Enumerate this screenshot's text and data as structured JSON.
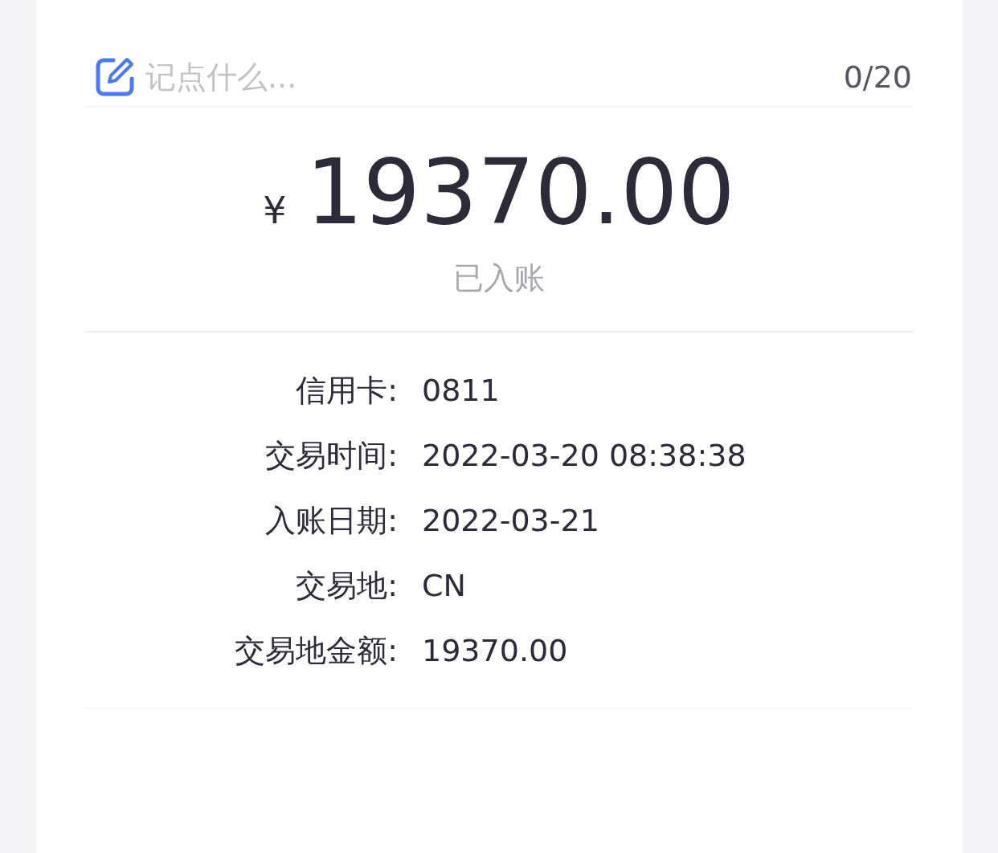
{
  "note": {
    "placeholder": "记点什么...",
    "counter": "0/20"
  },
  "amount": {
    "currency": "¥",
    "value": "19370.00",
    "status": "已入账"
  },
  "details": [
    {
      "label": "信用卡:",
      "value": "0811"
    },
    {
      "label": "交易时间:",
      "value": "2022-03-20 08:38:38"
    },
    {
      "label": "入账日期:",
      "value": "2022-03-21"
    },
    {
      "label": "交易地:",
      "value": "CN"
    },
    {
      "label": "交易地金额:",
      "value": "19370.00"
    }
  ]
}
